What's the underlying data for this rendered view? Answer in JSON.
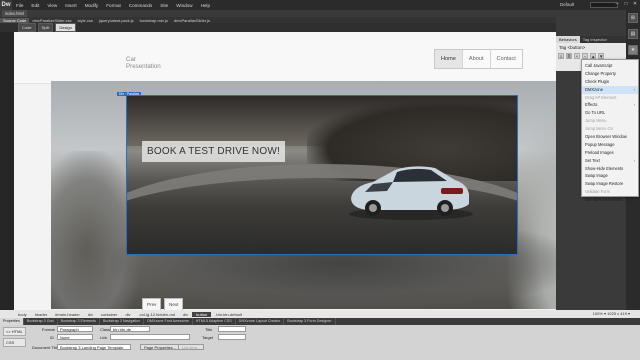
{
  "app": {
    "logo": "Dw",
    "workspace": "Default"
  },
  "menu": [
    "File",
    "Edit",
    "View",
    "Insert",
    "Modify",
    "Format",
    "Commands",
    "Site",
    "Window",
    "Help"
  ],
  "window_controls": [
    "–",
    "□",
    "✕"
  ],
  "doc_tab": "index.html",
  "related_files": [
    "Source Code",
    "dmxParallaxSlider.css",
    "style.css",
    "jquery.latest.pack.js",
    "bootstrap.min.js",
    "dmxParallaxSlider.js"
  ],
  "views": [
    "Code",
    "Split",
    "Design"
  ],
  "active_view": "Design",
  "page": {
    "brand": [
      "Car",
      "Presentation"
    ],
    "nav": [
      "Home",
      "About",
      "Contact"
    ],
    "nav_active": "Home",
    "carousel_label": "Div · Parallax",
    "cta": "BOOK A TEST DRIVE NOW!",
    "prev": "Prev",
    "next": "Next"
  },
  "behaviors_panel": {
    "tabs": [
      "Behaviors",
      "Tag Inspector"
    ],
    "active_tab": "Behaviors",
    "tag_label": "Tag <button>",
    "tools": [
      "≡",
      "≣",
      "+",
      "−",
      "▲",
      "▼"
    ]
  },
  "behaviors_menu": [
    {
      "label": "Call JavaScript",
      "enabled": true
    },
    {
      "label": "Change Property",
      "enabled": true
    },
    {
      "label": "Check Plugin",
      "enabled": true
    },
    {
      "label": "DMXzone",
      "enabled": true,
      "submenu": true,
      "highlight": true
    },
    {
      "label": "Drag AP Element",
      "enabled": false
    },
    {
      "label": "Effects",
      "enabled": true,
      "submenu": true
    },
    {
      "label": "Go To URL",
      "enabled": true
    },
    {
      "label": "Jump Menu",
      "enabled": false
    },
    {
      "label": "Jump Menu Go",
      "enabled": false
    },
    {
      "label": "Open Browser Window",
      "enabled": true
    },
    {
      "label": "Popup Message",
      "enabled": true
    },
    {
      "label": "Preload Images",
      "enabled": true
    },
    {
      "label": "Set Text",
      "enabled": true,
      "submenu": true
    },
    {
      "label": "Show-Hide Elements",
      "enabled": true
    },
    {
      "label": "Swap Image",
      "enabled": true
    },
    {
      "label": "Swap Image Restore",
      "enabled": true
    },
    {
      "label": "Validate Form",
      "enabled": false
    },
    {
      "label": "Get More Behaviors...",
      "enabled": true
    }
  ],
  "right_strip_icons": [
    "behaviors-icon",
    "files-icon",
    "assets-icon",
    "insert-icon",
    "css-icon"
  ],
  "tag_selector": [
    "body",
    "header",
    "#main-header",
    "div",
    "container",
    "div",
    ".col-lg-12.hidden-md",
    "div",
    "button",
    ".btn.btn-default"
  ],
  "tag_selected_index": 8,
  "doc_size": "100% ▾  1025 x 419 ▾",
  "bottom_tabs": [
    "Properties",
    "Bootstrap 3 Grid",
    "Bootstrap 3 Elements",
    "Bootstrap 3 Navigation",
    "DMXzone Font Awesome",
    "HTML5 Adaptive CSS",
    "DMXzone Layout Creator",
    "Bootstrap 3 Form Designer"
  ],
  "properties": {
    "modes": [
      "<> HTML",
      "CSS"
    ],
    "format_label": "Format",
    "format_value": "Paragraph",
    "id_label": "ID",
    "id_value": "None",
    "class_label": "Class",
    "class_value": "btn btn-de",
    "link_label": "Link",
    "title_label": "Title",
    "target_label": "Target",
    "doc_title_label": "Document Title",
    "doc_title_value": "Bootstrap 3 Landing Page Template",
    "page_props": "Page Properties...",
    "list_item": "List Item..."
  },
  "colors": {
    "accent": "#2a6fbf",
    "menu_highlight": "#cfe3f8",
    "chrome": "#2b2b2b"
  }
}
